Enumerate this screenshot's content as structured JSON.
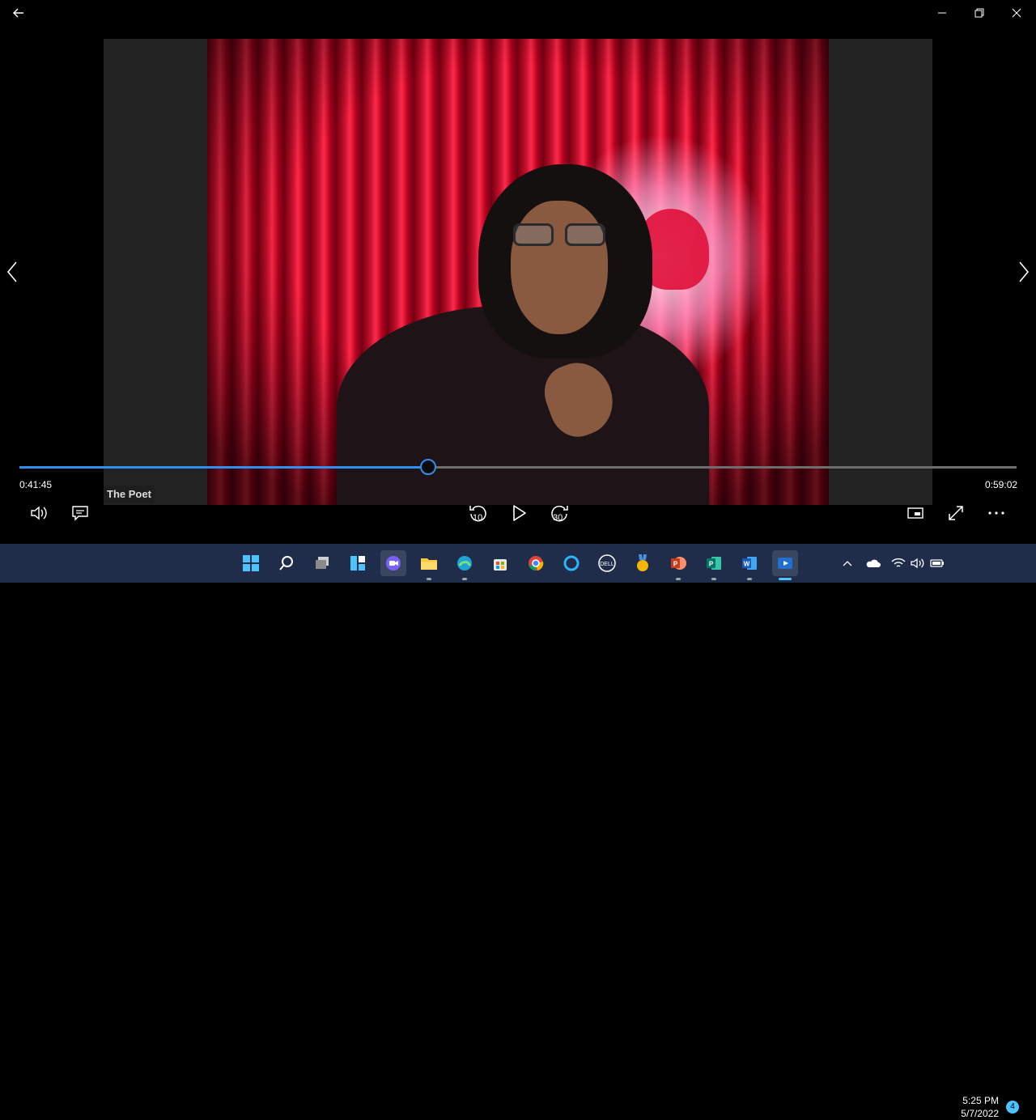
{
  "video": {
    "speaker_name": "The Poet"
  },
  "player": {
    "current_time": "0:41:45",
    "total_time": "0:59:02",
    "progress_fraction": 0.41,
    "skip_back_seconds": "10",
    "skip_forward_seconds": "30",
    "accent_color": "#2f8ff0"
  },
  "taskbar": {
    "time": "5:25 PM",
    "date": "5/7/2022",
    "notification_count": "4",
    "apps": [
      "start-icon",
      "search-icon",
      "task-view-icon",
      "widgets-icon",
      "teams-chat-icon",
      "file-explorer-icon",
      "edge-icon",
      "store-icon",
      "chrome-icon",
      "cortana-icon",
      "dell-icon",
      "achievement-icon",
      "powerpoint-icon",
      "publisher-icon",
      "word-icon",
      "movies-tv-icon"
    ]
  }
}
